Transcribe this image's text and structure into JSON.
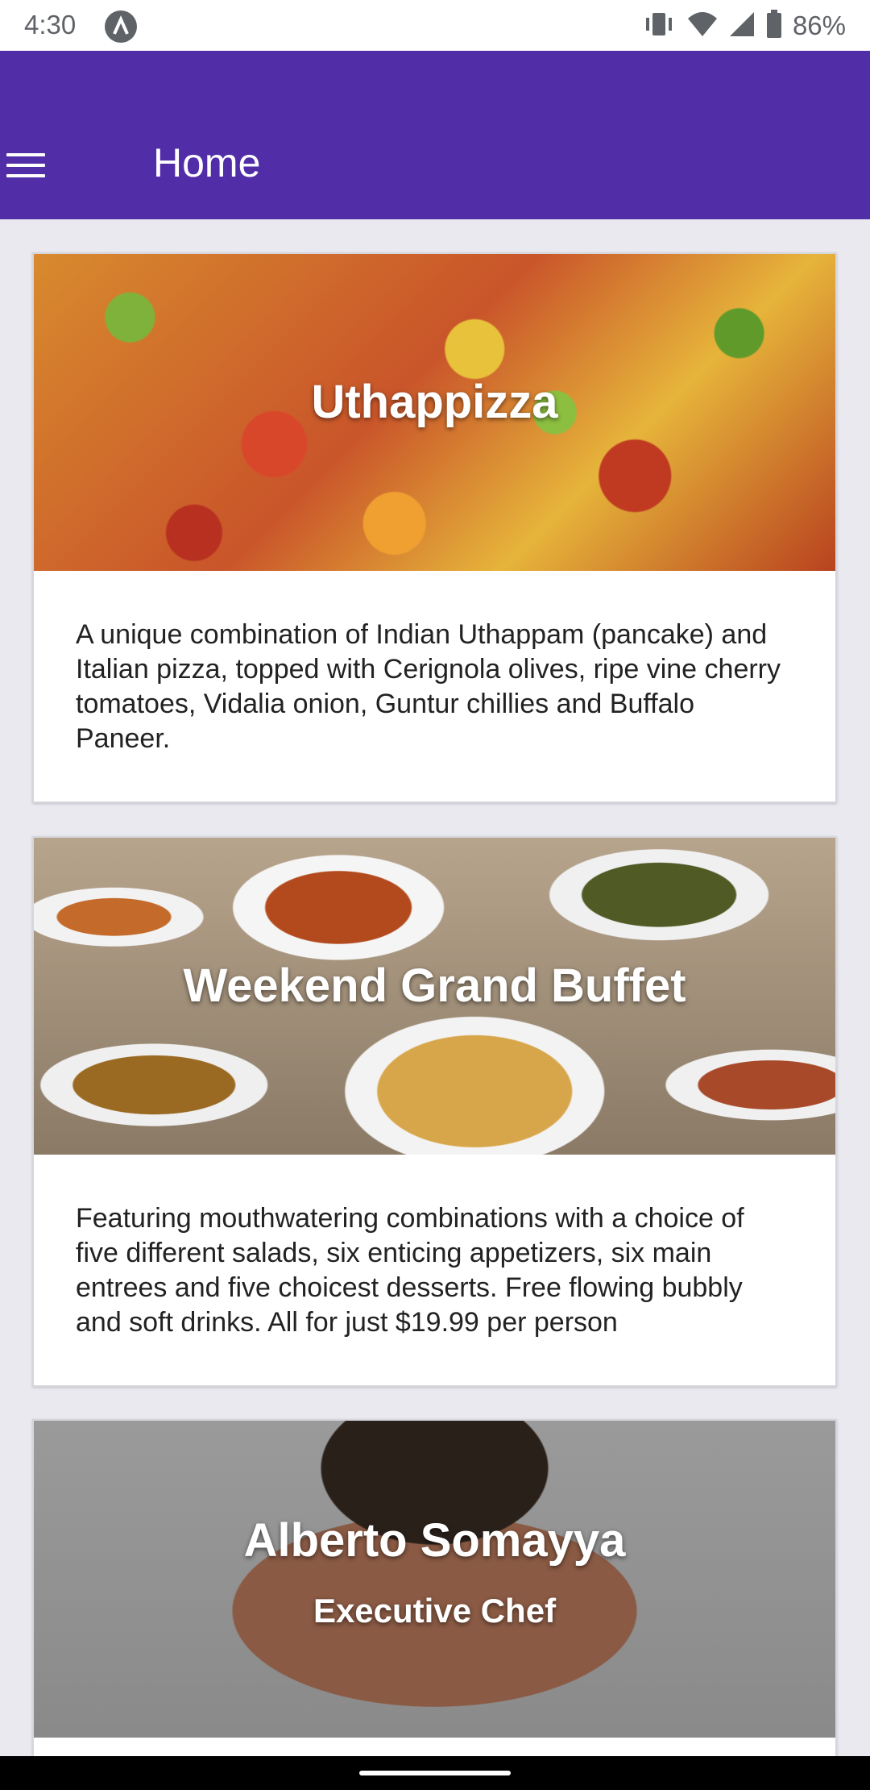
{
  "status_bar": {
    "time": "4:30",
    "battery": "86%"
  },
  "toolbar": {
    "title": "Home",
    "background": "#512DA8"
  },
  "cards": [
    {
      "title": "Uthappizza",
      "description": "A unique combination of Indian Uthappam (pancake) and Italian pizza, topped with Cerignola olives, ripe vine cherry tomatoes, Vidalia onion, Guntur chillies and Buffalo Paneer."
    },
    {
      "title": "Weekend Grand Buffet",
      "description": "Featuring mouthwatering combinations with a choice of five different salads, six enticing appetizers, six main entrees and five choicest desserts. Free flowing bubbly and soft drinks. All for just $19.99 per person"
    },
    {
      "title": "Alberto Somayya",
      "subtitle": "Executive Chef"
    }
  ]
}
